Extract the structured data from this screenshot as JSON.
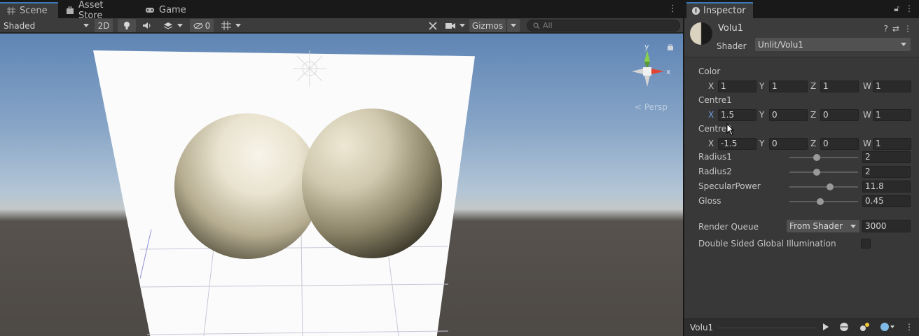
{
  "scene": {
    "tabs": [
      {
        "label": "Scene",
        "icon": "grid-icon"
      },
      {
        "label": "Asset Store",
        "icon": "bag-icon"
      },
      {
        "label": "Game",
        "icon": "gamepad-icon"
      }
    ],
    "toolbar": {
      "draw_mode": "Shaded",
      "mode_2d": "2D",
      "hidden_count": "0",
      "gizmos": "Gizmos",
      "search_placeholder": "All"
    },
    "gizmo": {
      "y_label": "y",
      "x_label": "x"
    },
    "projection": "< Persp"
  },
  "inspector": {
    "tab_label": "Inspector",
    "material_name": "Volu1",
    "shader_label": "Shader",
    "shader_value": "Unlit/Volu1",
    "properties": {
      "color": {
        "label": "Color",
        "x": "1",
        "y": "1",
        "z": "1",
        "w": "1"
      },
      "centre1": {
        "label": "Centre1",
        "x": "1.5",
        "y": "0",
        "z": "0",
        "w": "1"
      },
      "centre2": {
        "label": "Centre2",
        "x": "-1.5",
        "y": "0",
        "z": "0",
        "w": "1"
      },
      "radius1": {
        "label": "Radius1",
        "value": "2",
        "fraction": 0.4
      },
      "radius2": {
        "label": "Radius2",
        "value": "2",
        "fraction": 0.4
      },
      "specular_power": {
        "label": "SpecularPower",
        "value": "11.8",
        "fraction": 0.59
      },
      "gloss": {
        "label": "Gloss",
        "value": "0.45",
        "fraction": 0.45
      }
    },
    "axis_labels": {
      "x": "X",
      "y": "Y",
      "z": "Z",
      "w": "W"
    },
    "render_queue": {
      "label": "Render Queue",
      "mode": "From Shader",
      "value": "3000"
    },
    "double_sided_gi": {
      "label": "Double Sided Global Illumination",
      "checked": false
    },
    "preview": {
      "name": "Volu1"
    }
  }
}
